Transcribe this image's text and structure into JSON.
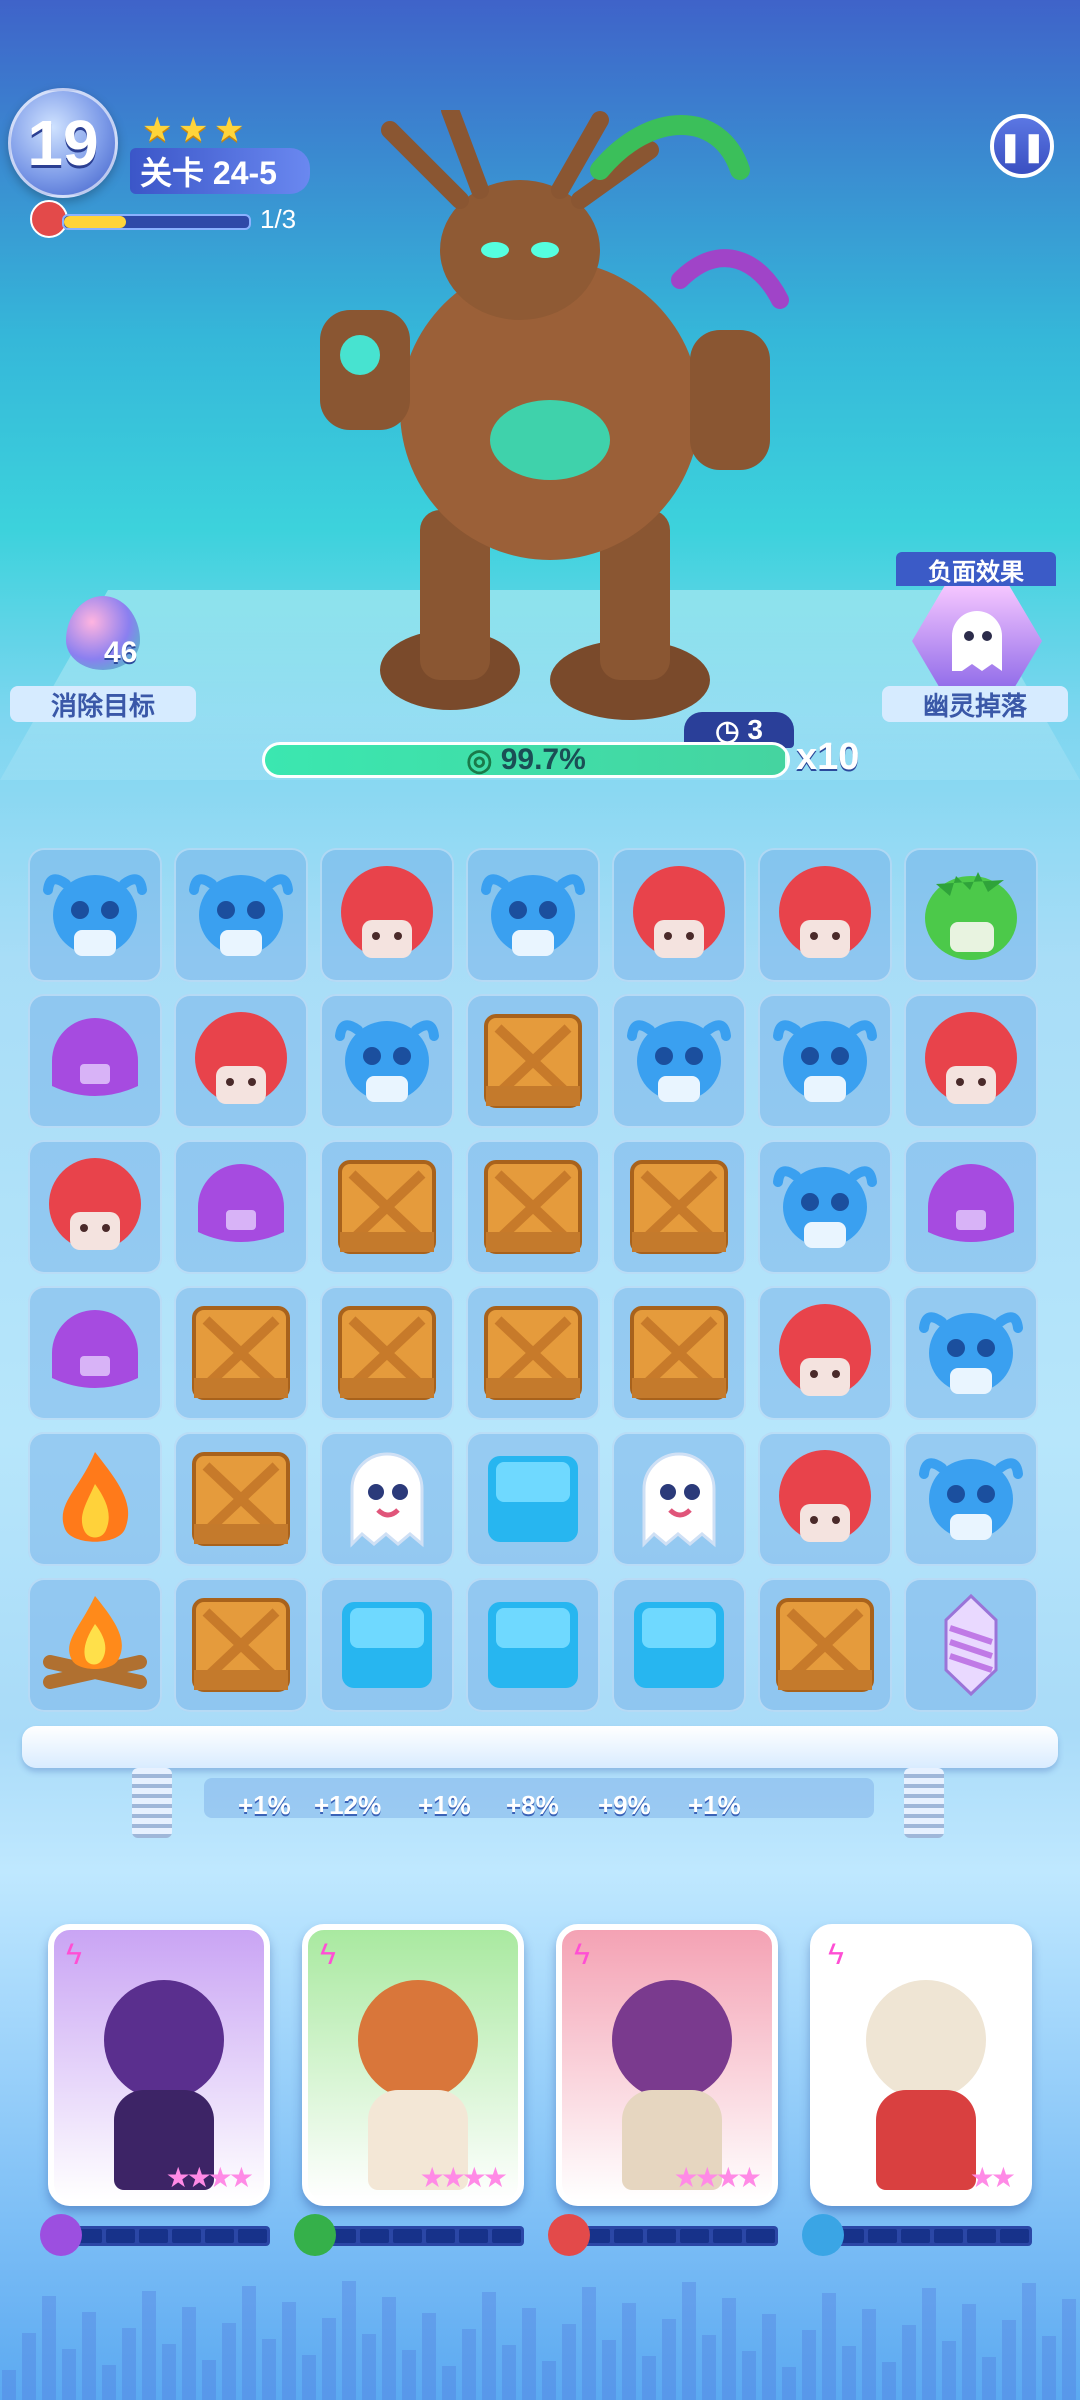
{
  "hud": {
    "moves": "19",
    "level_label": "关卡 24-5",
    "stars": [
      "★",
      "★",
      "★"
    ],
    "progress_text": "1/3",
    "progress_fraction": 0.333,
    "pause_icon": "pause-icon"
  },
  "target": {
    "label": "消除目标",
    "count": "46",
    "icon": "rainbow-drop-icon"
  },
  "debuff": {
    "title": "负面效果",
    "label": "幽灵掉落",
    "icon": "ghost-icon"
  },
  "boss": {
    "name_icon": "tree-golem-boss",
    "timer": "3",
    "hp_text": "99.7%",
    "hp_fraction": 0.997,
    "multiplier": "x10"
  },
  "board": {
    "rows": [
      [
        "blue-bull",
        "blue-bull",
        "red-lion",
        "blue-bull",
        "red-lion",
        "red-lion",
        "green-dino"
      ],
      [
        "purple-helmet",
        "red-lion",
        "blue-bull",
        "crate",
        "blue-bull",
        "blue-bull",
        "red-lion"
      ],
      [
        "red-lion",
        "purple-helmet",
        "crate",
        "crate",
        "crate",
        "blue-bull",
        "purple-helmet"
      ],
      [
        "purple-helmet",
        "crate",
        "crate",
        "crate",
        "crate",
        "red-lion",
        "blue-bull"
      ],
      [
        "fire",
        "crate",
        "ghost",
        "ice-block",
        "ghost",
        "red-lion",
        "blue-bull"
      ],
      [
        "campfire",
        "crate",
        "ice-block",
        "ice-block",
        "ice-block",
        "crate",
        "drill"
      ]
    ]
  },
  "bonuses": [
    "+1%",
    "+12%",
    "+1%",
    "+8%",
    "+9%",
    "+1%"
  ],
  "heroes": [
    {
      "name": "robot-hero",
      "stars": "★★★★",
      "color": "#c9a4f4",
      "charge_color": "#9c4fe0"
    },
    {
      "name": "bear-hood-hero",
      "stars": "★★★★",
      "color": "#a9e9a0",
      "charge_color": "#35b04a"
    },
    {
      "name": "skull-mask-hero",
      "stars": "★★★★",
      "color": "#f4a2b4",
      "charge_color": "#e34a4a"
    },
    {
      "name": "skull-hat-hero",
      "stars": "★★",
      "color": "#ffffff",
      "charge_color": "#3aa5e5"
    }
  ],
  "colors": {
    "blue-bull": "#3aa0f0",
    "red-lion": "#e8434b",
    "purple-helmet": "#a64be0",
    "green-dino": "#4cc94a",
    "crate": "#e59b3c",
    "ice-block": "#27b6f0"
  }
}
